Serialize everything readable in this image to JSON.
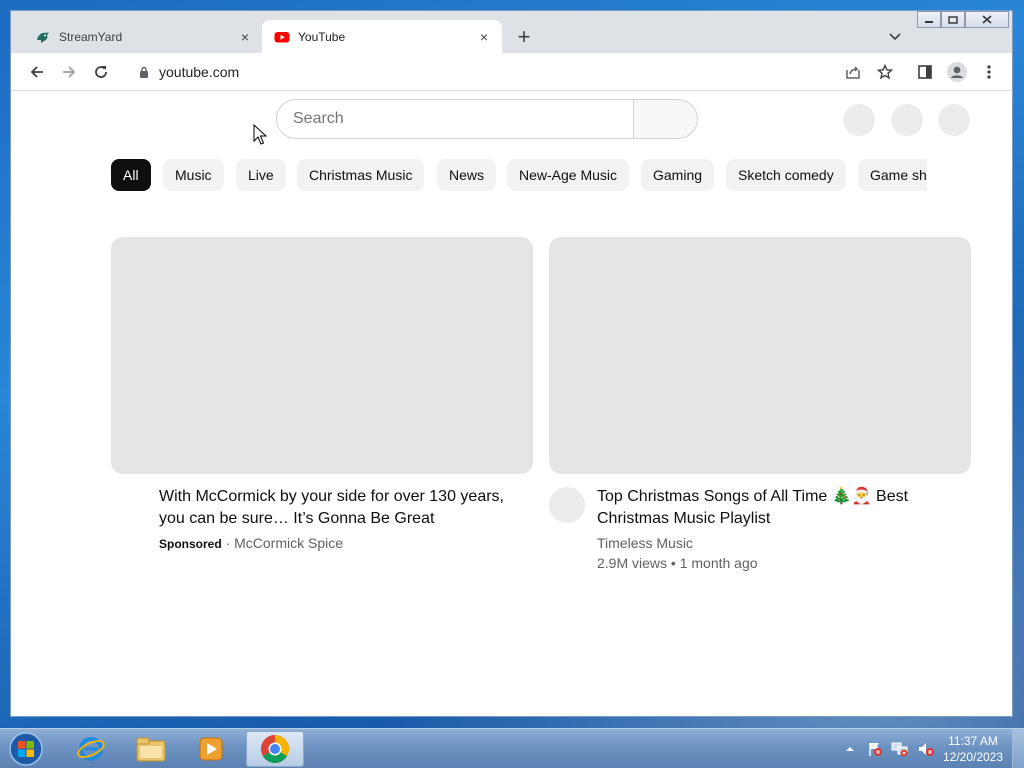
{
  "browser": {
    "tabs": [
      {
        "title": "StreamYard",
        "favicon": "streamyard-logo-icon",
        "active": false
      },
      {
        "title": "YouTube",
        "favicon": "youtube-logo-icon",
        "active": true
      }
    ],
    "new_tab_symbol": "+",
    "close_symbol": "×",
    "address": "youtube.com",
    "window_controls": {
      "minimize": "—",
      "maximize": "□",
      "close": "✕"
    }
  },
  "youtube": {
    "search_placeholder": "Search",
    "chips": [
      "All",
      "Music",
      "Live",
      "Christmas Music",
      "News",
      "New-Age Music",
      "Gaming",
      "Sketch comedy",
      "Game shows"
    ],
    "selected_chip": "All",
    "videos": [
      {
        "title": "With McCormick by your side for over 130 years, you can be sure… It’s Gonna Be Great",
        "sponsored_label": "Sponsored",
        "separator": "·",
        "channel": "McCormick Spice"
      },
      {
        "title": "Top Christmas Songs of All Time 🎄🎅 Best Christmas Music Playlist",
        "channel": "Timeless Music",
        "stats": "2.9M views • 1 month ago"
      }
    ]
  },
  "taskbar": {
    "apps": [
      "start-orb-icon",
      "internet-explorer-icon",
      "file-explorer-icon",
      "media-player-icon",
      "chrome-icon"
    ],
    "clock_time": "11:37 AM",
    "clock_date": "12/20/2023"
  },
  "colors": {
    "chip_selected_bg": "#0f0f0f",
    "chip_bg": "#f2f2f2",
    "thumbnail_placeholder": "#e5e5e5",
    "youtube_red": "#ff0000"
  }
}
